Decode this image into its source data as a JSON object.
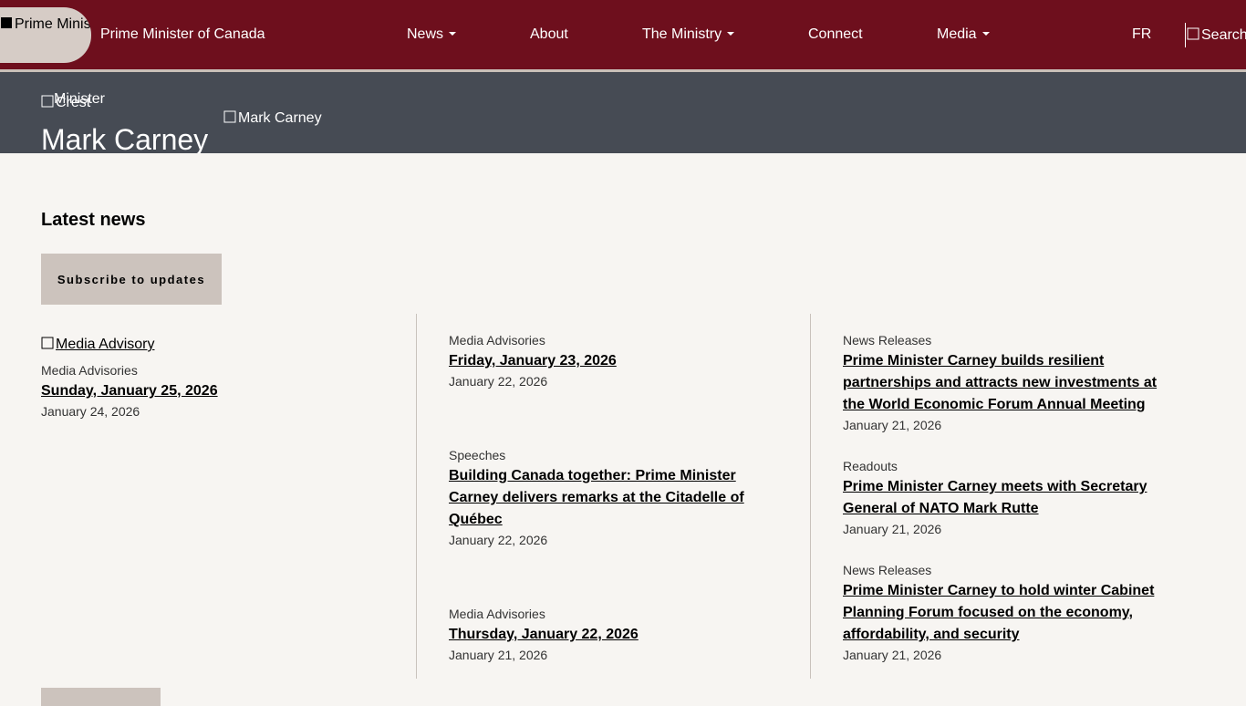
{
  "header": {
    "logo_alt": "Prime Minister of Canada",
    "site_name": "Prime Minister of Canada",
    "nav": [
      {
        "label": "News"
      },
      {
        "label": "About"
      },
      {
        "label": "The Ministry"
      },
      {
        "label": "Connect"
      },
      {
        "label": "Media"
      }
    ],
    "language": "FR",
    "search_alt": "Search"
  },
  "hero": {
    "crest_alt": "Crest",
    "crest_alt_overlay": "Minister",
    "name": "Mark Carney",
    "photo_alt": "Mark Carney"
  },
  "latest_news": {
    "title": "Latest news",
    "subscribe_label": "Subscribe to updates",
    "featured_image_alt": "Media Advisory",
    "columns": [
      [
        {
          "category": "Media Advisories",
          "title": "Sunday, January 25, 2026",
          "date": "January 24, 2026"
        }
      ],
      [
        {
          "category": "Media Advisories",
          "title": "Friday, January 23, 2026",
          "date": "January 22, 2026"
        },
        {
          "category": "Speeches",
          "title": "Building Canada together: Prime Minister Carney delivers remarks at the Citadelle of Québec",
          "date": "January 22, 2026"
        },
        {
          "category": "Media Advisories",
          "title": "Thursday, January 22, 2026",
          "date": "January 21, 2026"
        }
      ],
      [
        {
          "category": "News Releases",
          "title": "Prime Minister Carney builds resilient partnerships and attracts new investments at the World Economic Forum Annual Meeting",
          "date": "January 21, 2026"
        },
        {
          "category": "Readouts",
          "title": "Prime Minister Carney meets with Secretary General of NATO Mark Rutte",
          "date": "January 21, 2026"
        },
        {
          "category": "News Releases",
          "title": "Prime Minister Carney to hold winter Cabinet Planning Forum focused on the economy, affordability, and security",
          "date": "January 21, 2026"
        }
      ]
    ]
  }
}
